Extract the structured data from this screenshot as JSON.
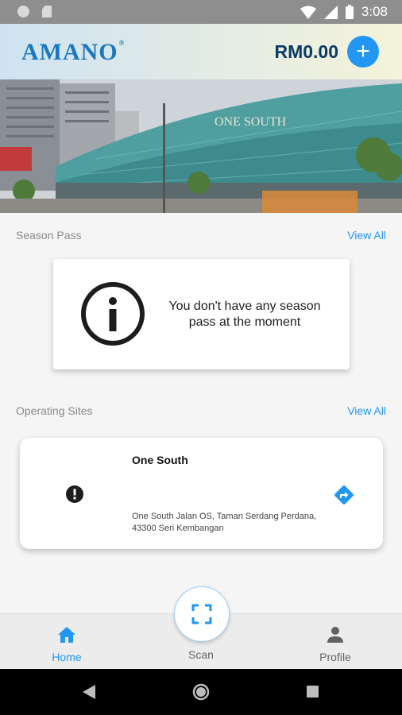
{
  "status_bar": {
    "time": "3:08"
  },
  "header": {
    "logo": "AMANO",
    "balance": "RM0.00",
    "add_label": "+"
  },
  "hero": {
    "sign_text": "ONE SOUTH"
  },
  "season_pass": {
    "title": "Season Pass",
    "view_all": "View All",
    "empty_message": "You don't have any season pass at the moment"
  },
  "operating_sites": {
    "title": "Operating Sites",
    "view_all": "View All",
    "sites": [
      {
        "name": "One South",
        "address": "One South Jalan OS, Taman Serdang Perdana, 43300 Seri Kembangan"
      }
    ]
  },
  "bottom_nav": {
    "items": [
      {
        "label": "Home",
        "icon": "home-icon",
        "active": true
      },
      {
        "label": "Scan",
        "icon": "scan-icon",
        "active": false
      },
      {
        "label": "Profile",
        "icon": "person-icon",
        "active": false
      }
    ]
  },
  "colors": {
    "accent": "#2196f3",
    "balance": "#0b3a66",
    "logo": "#1a78c2"
  }
}
